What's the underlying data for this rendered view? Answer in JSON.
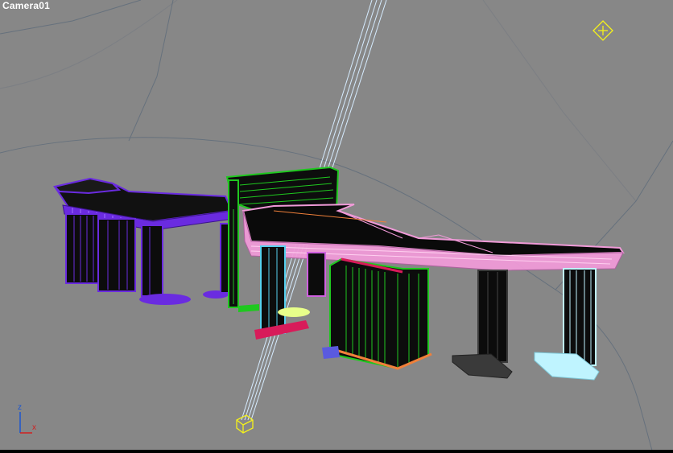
{
  "viewport": {
    "label": "Camera01"
  },
  "axis_gizmo": {
    "z": "z",
    "x": "x"
  },
  "colors": {
    "background": "#878787",
    "grid": "#6a7480",
    "wire_purple": "#6a2be0",
    "wire_green": "#1fc81f",
    "wire_pink": "#f09ad8",
    "wire_cyan": "#56d0ee",
    "wire_crimson": "#d81b5a",
    "wire_orange": "#f0803a",
    "wire_light_cyan": "#bff4ff",
    "wire_dark": "#3a3a3a",
    "camera_target": "#f5f21a",
    "camera_beam": "#cfe8ff"
  }
}
